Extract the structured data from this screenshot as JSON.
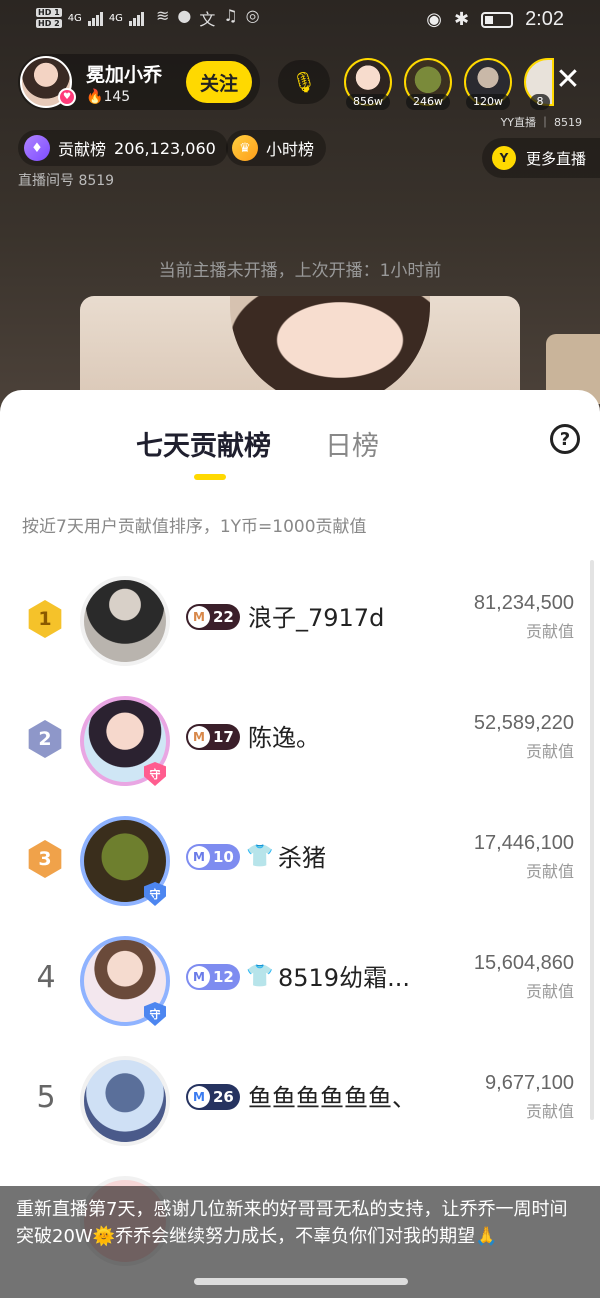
{
  "status_bar": {
    "hd1": "HD 1",
    "hd2": "HD 2",
    "net1": "4G",
    "net2": "4G",
    "time": "2:02"
  },
  "anchor": {
    "name": "冕加小乔",
    "fans": "145",
    "follow_label": "关注"
  },
  "viewers": [
    {
      "badge": "856w"
    },
    {
      "badge": "246w"
    },
    {
      "badge": "120w"
    },
    {
      "badge": "8"
    }
  ],
  "yy_line": "YY直播 ｜ 8519",
  "contribution": {
    "label": "贡献榜",
    "value": "206,123,060",
    "hourly_label": "小时榜"
  },
  "room_id": "直播间号 8519",
  "more_live": "更多直播",
  "offline_tip": "当前主播未开播，上次开播：1小时前",
  "panel": {
    "tabs": [
      "七天贡献榜",
      "日榜"
    ],
    "active_tab": 0,
    "description": "按近7天用户贡献值排序，1Y币=1000贡献值",
    "help": "?",
    "value_label": "贡献值"
  },
  "ranking": [
    {
      "rank": "1",
      "level": "22",
      "level_style": "dark",
      "name": "浪子_7917d",
      "value": "81,234,500",
      "has_shirt": false,
      "guard": false
    },
    {
      "rank": "2",
      "level": "17",
      "level_style": "dark",
      "name": "陈逸。",
      "value": "52,589,220",
      "has_shirt": false,
      "guard": true
    },
    {
      "rank": "3",
      "level": "10",
      "level_style": "blue",
      "name": "杀猪",
      "value": "17,446,100",
      "has_shirt": true,
      "guard": true
    },
    {
      "rank": "4",
      "level": "12",
      "level_style": "blue",
      "name": "8519幼霜...",
      "value": "15,604,860",
      "has_shirt": true,
      "guard": true
    },
    {
      "rank": "5",
      "level": "26",
      "level_style": "navy",
      "name": "鱼鱼鱼鱼鱼鱼、",
      "value": "9,677,100",
      "has_shirt": false,
      "guard": false
    }
  ],
  "caption": "重新直播第7天，感谢几位新来的好哥哥无私的支持，让乔乔一周时间突破20W🌞乔乔会继续努力成长，不辜负你们对我的期望🙏",
  "colors": {
    "accent": "#ffd900",
    "gold": "#f5c22a",
    "silver": "#8e97c9",
    "bronze": "#f0a24a"
  }
}
